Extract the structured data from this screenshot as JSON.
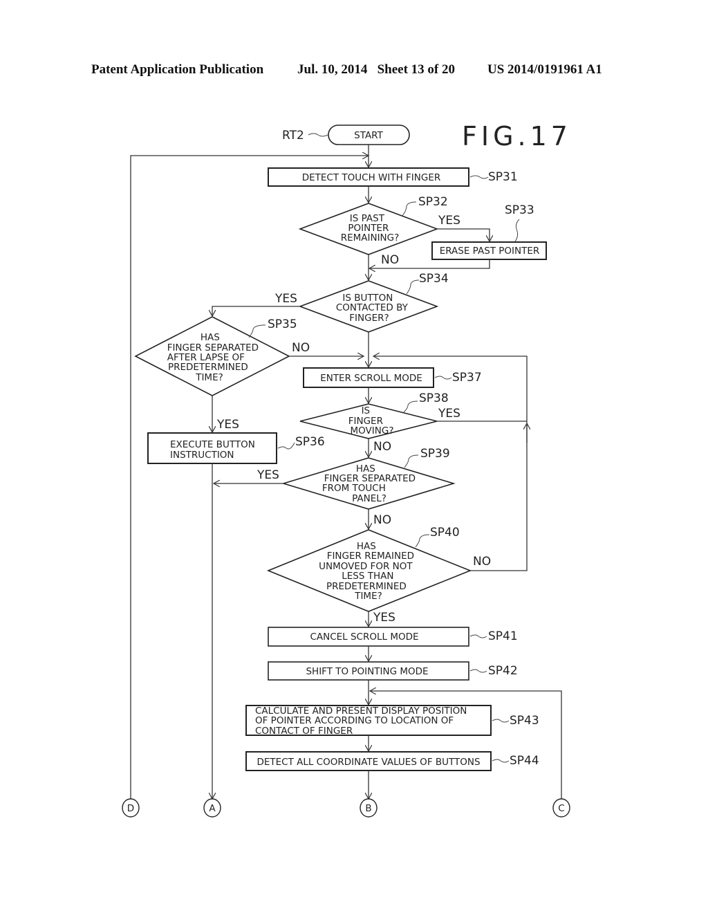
{
  "header": {
    "publication": "Patent Application Publication",
    "date_sheet": "Jul. 10, 2014   Sheet 13 of 20",
    "number": "US 2014/0191961 A1"
  },
  "figure": {
    "title": "FIG.17",
    "routine": "RT2"
  },
  "nodes": {
    "start": "START",
    "sp31": {
      "ref": "SP31",
      "lines": [
        "DETECT TOUCH WITH FINGER"
      ]
    },
    "sp32": {
      "ref": "SP32",
      "lines": [
        "IS PAST",
        "POINTER",
        "REMAINING?"
      ]
    },
    "sp33": {
      "ref": "SP33",
      "lines": [
        "ERASE PAST POINTER"
      ]
    },
    "sp34": {
      "ref": "SP34",
      "lines": [
        "IS BUTTON",
        "CONTACTED BY",
        "FINGER?"
      ]
    },
    "sp35": {
      "ref": "SP35",
      "lines": [
        "HAS",
        "FINGER SEPARATED",
        "AFTER LAPSE OF",
        "PREDETERMINED",
        "TIME?"
      ]
    },
    "sp36": {
      "ref": "SP36",
      "lines": [
        "EXECUTE BUTTON",
        "INSTRUCTION"
      ]
    },
    "sp37": {
      "ref": "SP37",
      "lines": [
        "ENTER SCROLL MODE"
      ]
    },
    "sp38": {
      "ref": "SP38",
      "lines": [
        "IS",
        "FINGER",
        "MOVING?"
      ]
    },
    "sp39": {
      "ref": "SP39",
      "lines": [
        "HAS",
        "FINGER SEPARATED",
        "FROM TOUCH",
        "PANEL?"
      ]
    },
    "sp40": {
      "ref": "SP40",
      "lines": [
        "HAS",
        "FINGER REMAINED",
        "UNMOVED FOR NOT",
        "LESS THAN",
        "PREDETERMINED",
        "TIME?"
      ]
    },
    "sp41": {
      "ref": "SP41",
      "lines": [
        "CANCEL SCROLL MODE"
      ]
    },
    "sp42": {
      "ref": "SP42",
      "lines": [
        "SHIFT TO POINTING MODE"
      ]
    },
    "sp43": {
      "ref": "SP43",
      "lines": [
        "CALCULATE AND PRESENT DISPLAY POSITION",
        "OF POINTER ACCORDING TO LOCATION OF",
        "CONTACT OF FINGER"
      ]
    },
    "sp44": {
      "ref": "SP44",
      "lines": [
        "DETECT ALL COORDINATE VALUES OF BUTTONS"
      ]
    }
  },
  "branch_labels": {
    "yes": "YES",
    "no": "NO"
  },
  "connectors": [
    "D",
    "A",
    "B",
    "C"
  ]
}
